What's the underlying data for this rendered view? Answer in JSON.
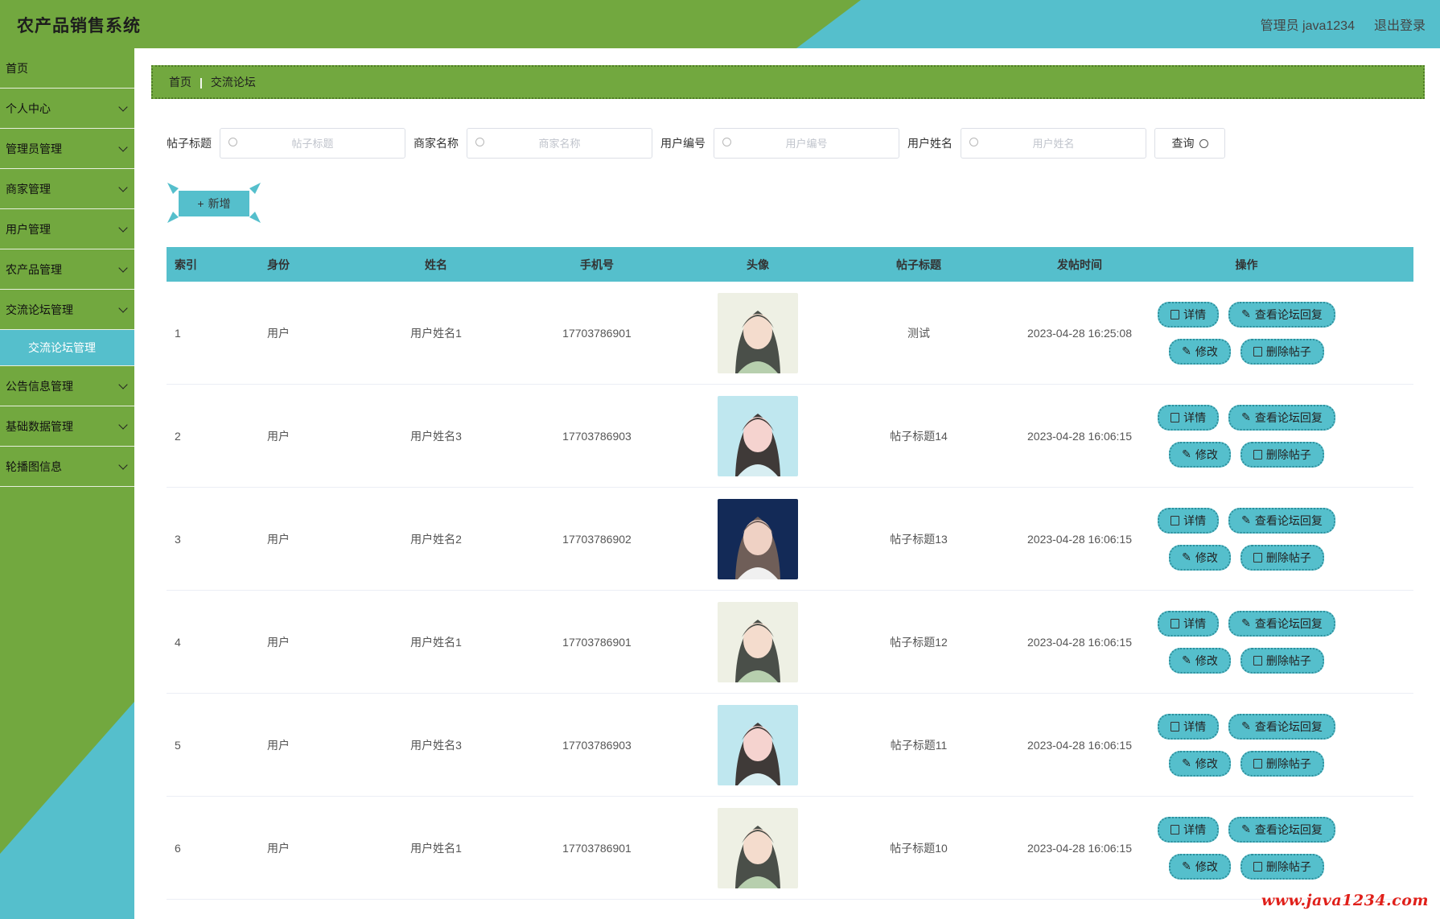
{
  "header": {
    "app_title": "农产品销售系统",
    "user_label": "管理员 java1234",
    "logout_label": "退出登录"
  },
  "sidebar": {
    "items": [
      {
        "label": "首页",
        "has_chevron": false
      },
      {
        "label": "个人中心",
        "has_chevron": true
      },
      {
        "label": "管理员管理",
        "has_chevron": true
      },
      {
        "label": "商家管理",
        "has_chevron": true
      },
      {
        "label": "用户管理",
        "has_chevron": true
      },
      {
        "label": "农产品管理",
        "has_chevron": true
      },
      {
        "label": "交流论坛管理",
        "has_chevron": true
      },
      {
        "label": "公告信息管理",
        "has_chevron": true
      },
      {
        "label": "基础数据管理",
        "has_chevron": true
      },
      {
        "label": "轮播图信息",
        "has_chevron": true
      }
    ],
    "active_sub": "交流论坛管理"
  },
  "breadcrumb": {
    "home": "首页",
    "current": "交流论坛"
  },
  "search": {
    "fields": [
      {
        "label": "帖子标题",
        "placeholder": "帖子标题",
        "value": ""
      },
      {
        "label": "商家名称",
        "placeholder": "商家名称",
        "value": ""
      },
      {
        "label": "用户编号",
        "placeholder": "用户编号",
        "value": ""
      },
      {
        "label": "用户姓名",
        "placeholder": "用户姓名",
        "value": ""
      }
    ],
    "query_label": "查询"
  },
  "add_button": "新增",
  "table": {
    "headers": [
      "索引",
      "身份",
      "姓名",
      "手机号",
      "头像",
      "帖子标题",
      "发帖时间",
      "操作"
    ],
    "rows": [
      {
        "index": "1",
        "role": "用户",
        "name": "用户姓名1",
        "phone": "17703786901",
        "avatar": "girl-green",
        "title": "测试",
        "time": "2023-04-28 16:25:08"
      },
      {
        "index": "2",
        "role": "用户",
        "name": "用户姓名3",
        "phone": "17703786903",
        "avatar": "girl-blue",
        "title": "帖子标题14",
        "time": "2023-04-28 16:06:15"
      },
      {
        "index": "3",
        "role": "用户",
        "name": "用户姓名2",
        "phone": "17703786902",
        "avatar": "boy-blue",
        "title": "帖子标题13",
        "time": "2023-04-28 16:06:15"
      },
      {
        "index": "4",
        "role": "用户",
        "name": "用户姓名1",
        "phone": "17703786901",
        "avatar": "girl-green",
        "title": "帖子标题12",
        "time": "2023-04-28 16:06:15"
      },
      {
        "index": "5",
        "role": "用户",
        "name": "用户姓名3",
        "phone": "17703786903",
        "avatar": "girl-blue",
        "title": "帖子标题11",
        "time": "2023-04-28 16:06:15"
      },
      {
        "index": "6",
        "role": "用户",
        "name": "用户姓名1",
        "phone": "17703786901",
        "avatar": "girl-green",
        "title": "帖子标题10",
        "time": "2023-04-28 16:06:15"
      }
    ],
    "actions": {
      "detail": "详情",
      "view_replies": "查看论坛回复",
      "edit": "修改",
      "delete": "删除帖子"
    }
  },
  "watermark": "www.java1234.com",
  "colors": {
    "green": "#72a83f",
    "teal": "#55bfcc",
    "watermark_red": "#e0201a"
  }
}
